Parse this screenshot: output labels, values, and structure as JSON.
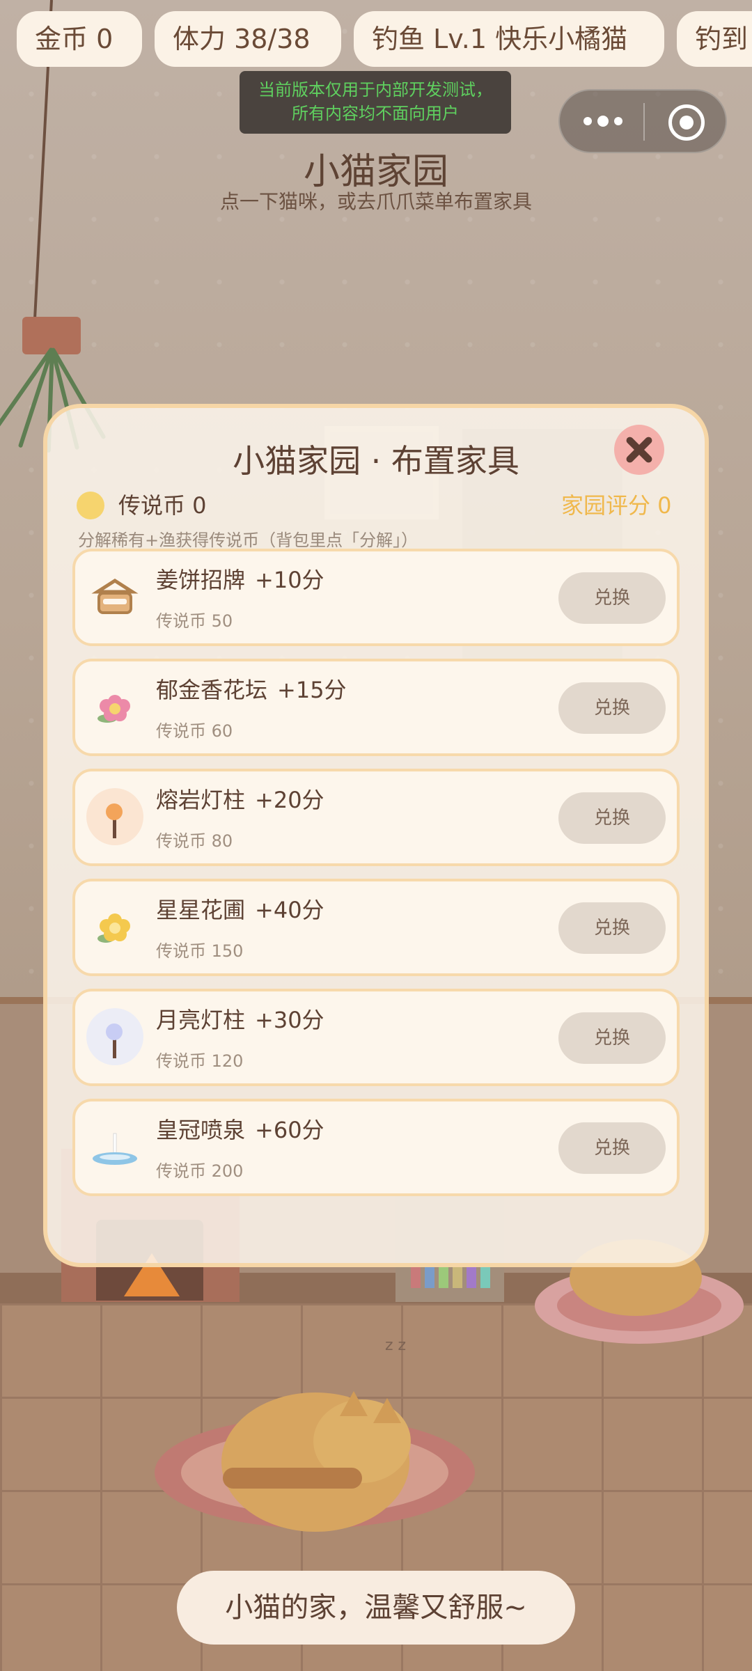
{
  "top_bar": {
    "gold": "金币  0",
    "stamina": "体力  38/38",
    "fishing": "钓鱼  Lv.1  快乐小橘猫",
    "checkin": "钓到"
  },
  "dev_banner": {
    "line1": "当前版本仅用于内部开发测试，",
    "line2": "所有内容均不面向用户"
  },
  "home": {
    "title": "小猫家园",
    "subtitle": "点一下猫咪，或去爪爪菜单布置家具"
  },
  "modal": {
    "title": "小猫家园 · 布置家具",
    "legend_coins": "传说币 0",
    "home_score": "家园评分 0",
    "hint": "分解稀有+渔获得传说币（背包里点「分解」）",
    "items": [
      {
        "name": "姜饼招牌",
        "score": "+10分",
        "price": "传说币 50",
        "button": "兑换",
        "icon": "gingerbread-sign-icon"
      },
      {
        "name": "郁金香花坛",
        "score": "+15分",
        "price": "传说币 60",
        "button": "兑换",
        "icon": "tulip-bed-icon"
      },
      {
        "name": "熔岩灯柱",
        "score": "+20分",
        "price": "传说币 80",
        "button": "兑换",
        "icon": "lava-lamp-post-icon"
      },
      {
        "name": "星星花圃",
        "score": "+40分",
        "price": "传说币 150",
        "button": "兑换",
        "icon": "star-flower-bed-icon"
      },
      {
        "name": "月亮灯柱",
        "score": "+30分",
        "price": "传说币 120",
        "button": "兑换",
        "icon": "moon-lamp-post-icon"
      },
      {
        "name": "皇冠喷泉",
        "score": "+60分",
        "price": "传说币 200",
        "button": "兑换",
        "icon": "crown-fountain-icon"
      }
    ]
  },
  "zz": "z z",
  "footer": {
    "message": "小猫的家，温馨又舒服~"
  },
  "colors": {
    "accent": "#f0b84c",
    "modal_border": "#f7d9ab",
    "close_bg": "#f4b0ab"
  }
}
